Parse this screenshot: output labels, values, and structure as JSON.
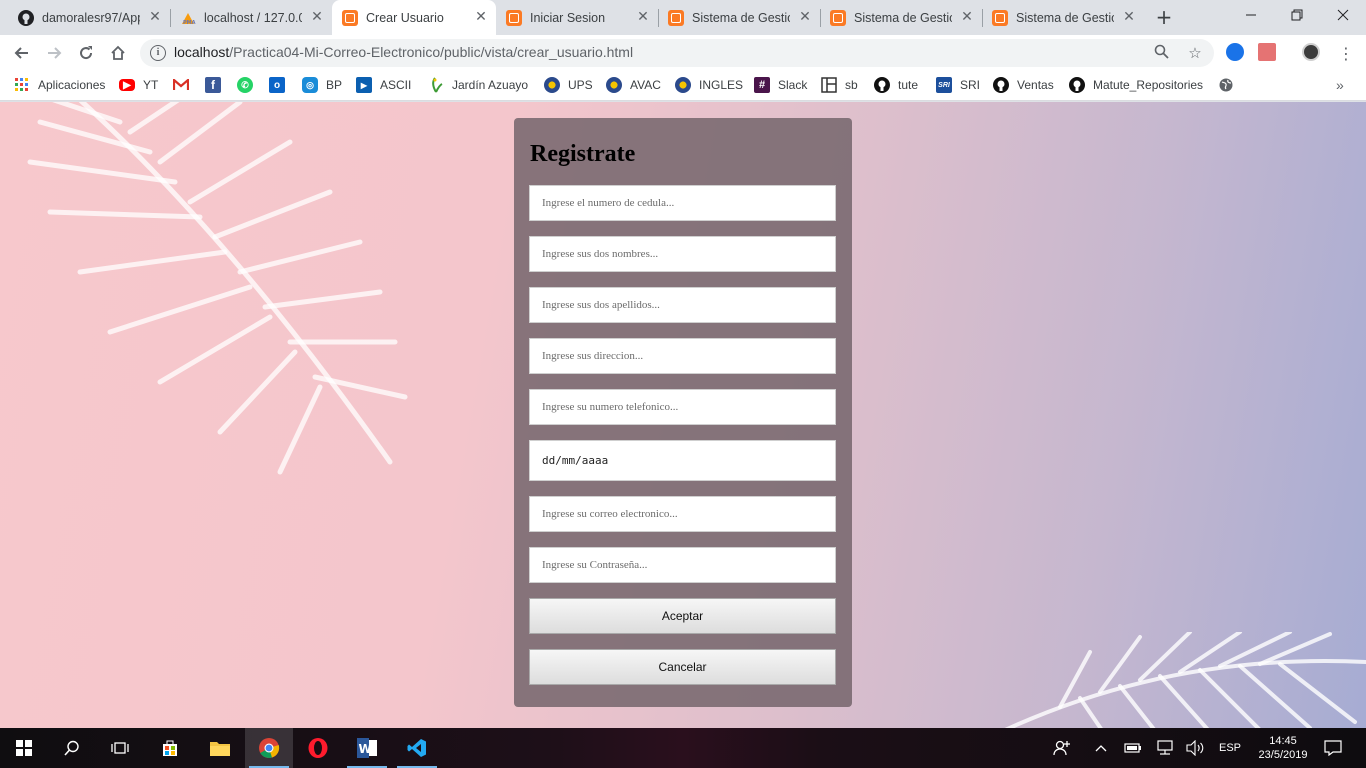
{
  "browser": {
    "tabs": [
      {
        "label": "damoralesr97/App",
        "icon": "github-icon",
        "active": false
      },
      {
        "label": "localhost / 127.0.0",
        "icon": "phpmyadmin-icon",
        "active": false
      },
      {
        "label": "Crear Usuario",
        "icon": "xampp-icon",
        "active": true
      },
      {
        "label": "Iniciar Sesion",
        "icon": "xampp-icon",
        "active": false
      },
      {
        "label": "Sistema de Gestion",
        "icon": "xampp-icon",
        "active": false
      },
      {
        "label": "Sistema de Gestion",
        "icon": "xampp-icon",
        "active": false
      },
      {
        "label": "Sistema de Gestion",
        "icon": "xampp-icon",
        "active": false
      }
    ],
    "url_host": "localhost",
    "url_path": "/Practica04-Mi-Correo-Electronico/public/vista/crear_usuario.html",
    "bookmarks": [
      {
        "label": "Aplicaciones",
        "icon": "apps-grid-icon",
        "color": "#e94235"
      },
      {
        "label": "YT",
        "icon": "youtube-icon",
        "color": "#ff0000"
      },
      {
        "label": "",
        "icon": "gmail-icon",
        "color": "#d93025"
      },
      {
        "label": "",
        "icon": "facebook-icon",
        "color": "#3b5998"
      },
      {
        "label": "",
        "icon": "whatsapp-icon",
        "color": "#25d366"
      },
      {
        "label": "",
        "icon": "outlook-icon",
        "color": "#0a64c8"
      },
      {
        "label": "BP",
        "icon": "bp-icon",
        "color": "#1a8cd8"
      },
      {
        "label": "ASCII",
        "icon": "ascii-icon",
        "color": "#0b5fb0"
      },
      {
        "label": "Jardín Azuayo",
        "icon": "jardin-azuayo-icon",
        "color": "#3d9b35"
      },
      {
        "label": "UPS",
        "icon": "ups-icon",
        "color": "#2b4a8c"
      },
      {
        "label": "AVAC",
        "icon": "avac-icon",
        "color": "#2b4a8c"
      },
      {
        "label": "INGLES",
        "icon": "ingles-icon",
        "color": "#2b4a8c"
      },
      {
        "label": "Slack",
        "icon": "slack-icon",
        "color": "#4a154b"
      },
      {
        "label": "sb",
        "icon": "sb-icon",
        "color": "#333333"
      },
      {
        "label": "tute",
        "icon": "github-icon",
        "color": "#000000"
      },
      {
        "label": "SRI",
        "icon": "sri-icon",
        "color": "#1c4f9c"
      },
      {
        "label": "Ventas",
        "icon": "github-icon",
        "color": "#000000"
      },
      {
        "label": "Matute_Repositories",
        "icon": "github-icon",
        "color": "#000000"
      }
    ]
  },
  "form": {
    "title": "Registrate",
    "placeholders": {
      "cedula": "Ingrese el numero de cedula...",
      "nombres": "Ingrese sus dos nombres...",
      "apellidos": "Ingrese sus dos apellidos...",
      "direccion": "Ingrese sus direccion...",
      "telefono": "Ingrese su numero telefonico...",
      "fecha": "dd/mm/aaaa",
      "correo": "Ingrese su correo electronico...",
      "contrasena": "Ingrese su Contraseña..."
    },
    "accept_label": "Aceptar",
    "cancel_label": "Cancelar"
  },
  "taskbar": {
    "language": "ESP",
    "time": "14:45",
    "date": "23/5/2019"
  },
  "colors": {
    "chrome_bg": "#dee1e6",
    "card_bg": "#786870",
    "accent_blue": "#1a73e8"
  }
}
